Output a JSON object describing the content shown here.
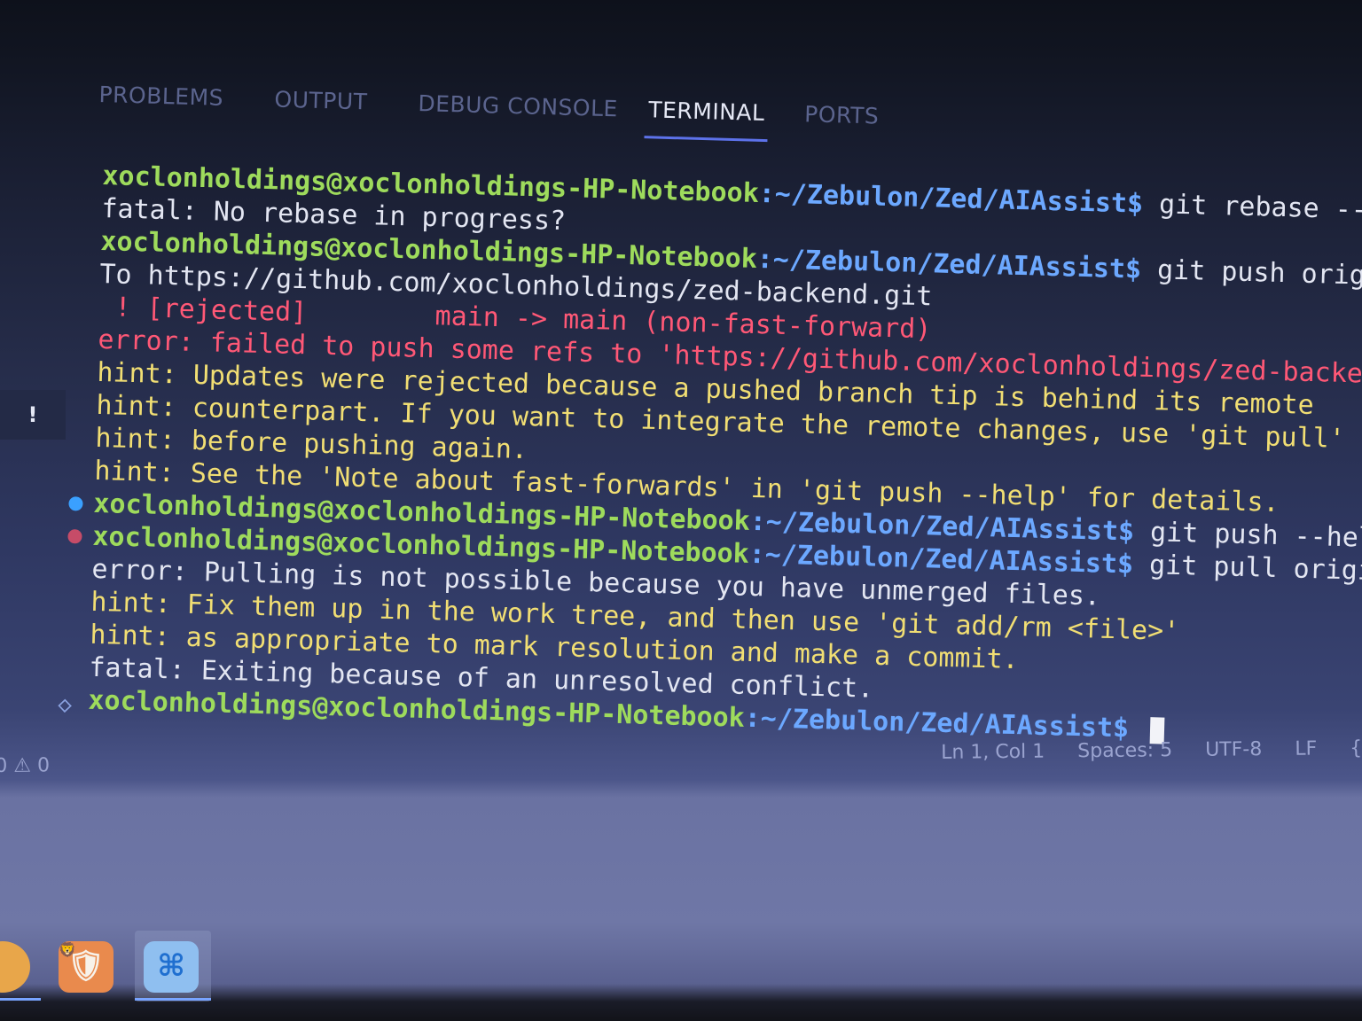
{
  "panel": {
    "tabs": [
      {
        "label": "PROBLEMS",
        "active": false
      },
      {
        "label": "OUTPUT",
        "active": false
      },
      {
        "label": "DEBUG CONSOLE",
        "active": false
      },
      {
        "label": "TERMINAL",
        "active": true
      },
      {
        "label": "PORTS",
        "active": false
      }
    ]
  },
  "terminal": {
    "prompt_user": "xoclonholdings@xoclonholdings-HP-Notebook",
    "prompt_path": ":~/Zebulon/Zed/AIAssist$",
    "lines": [
      {
        "type": "prompt",
        "cmd": " git rebase --c"
      },
      {
        "type": "plain",
        "text": "fatal: No rebase in progress?"
      },
      {
        "type": "prompt",
        "cmd": " git push origi"
      },
      {
        "type": "plain",
        "text": "To https://github.com/xoclonholdings/zed-backend.git"
      },
      {
        "type": "err",
        "text": " ! [rejected]        main -> main (non-fast-forward)"
      },
      {
        "type": "err",
        "text": "error: failed to push some refs to 'https://github.com/xoclonholdings/zed-backend"
      },
      {
        "type": "hint",
        "text": "hint: Updates were rejected because a pushed branch tip is behind its remote"
      },
      {
        "type": "hint",
        "text": "hint: counterpart. If you want to integrate the remote changes, use 'git pull'"
      },
      {
        "type": "hint",
        "text": "hint: before pushing again."
      },
      {
        "type": "hint",
        "text": "hint: See the 'Note about fast-forwards' in 'git push --help' for details."
      },
      {
        "type": "prompt",
        "deco": "ok",
        "cmd": " git push --help"
      },
      {
        "type": "prompt",
        "deco": "fail",
        "cmd": " git pull origin "
      },
      {
        "type": "plain",
        "text": "error: Pulling is not possible because you have unmerged files."
      },
      {
        "type": "hint",
        "text": "hint: Fix them up in the work tree, and then use 'git add/rm <file>'"
      },
      {
        "type": "hint",
        "text": "hint: as appropriate to mark resolution and make a commit."
      },
      {
        "type": "plain",
        "text": "fatal: Exiting because of an unresolved conflict."
      },
      {
        "type": "prompt",
        "deco": "plain",
        "cmd": " ",
        "cursor": true
      }
    ]
  },
  "side_badge": "!",
  "statusbar": {
    "problems": "0 ⚠ 0",
    "position": "Ln 1, Col 1",
    "spaces": "Spaces: 5",
    "encoding": "UTF-8",
    "eol": "LF",
    "extra": "{"
  },
  "taskbar": {
    "apps": [
      {
        "name": "chrome",
        "glyph": ""
      },
      {
        "name": "brave",
        "glyph": "🛡"
      },
      {
        "name": "vscode",
        "glyph": "⌘"
      }
    ]
  },
  "colors": {
    "prompt_user": "#9edb5c",
    "prompt_path": "#6ca8ff",
    "error": "#ff5876",
    "hint": "#f1de73",
    "active_tab_underline": "#5d72ea"
  }
}
